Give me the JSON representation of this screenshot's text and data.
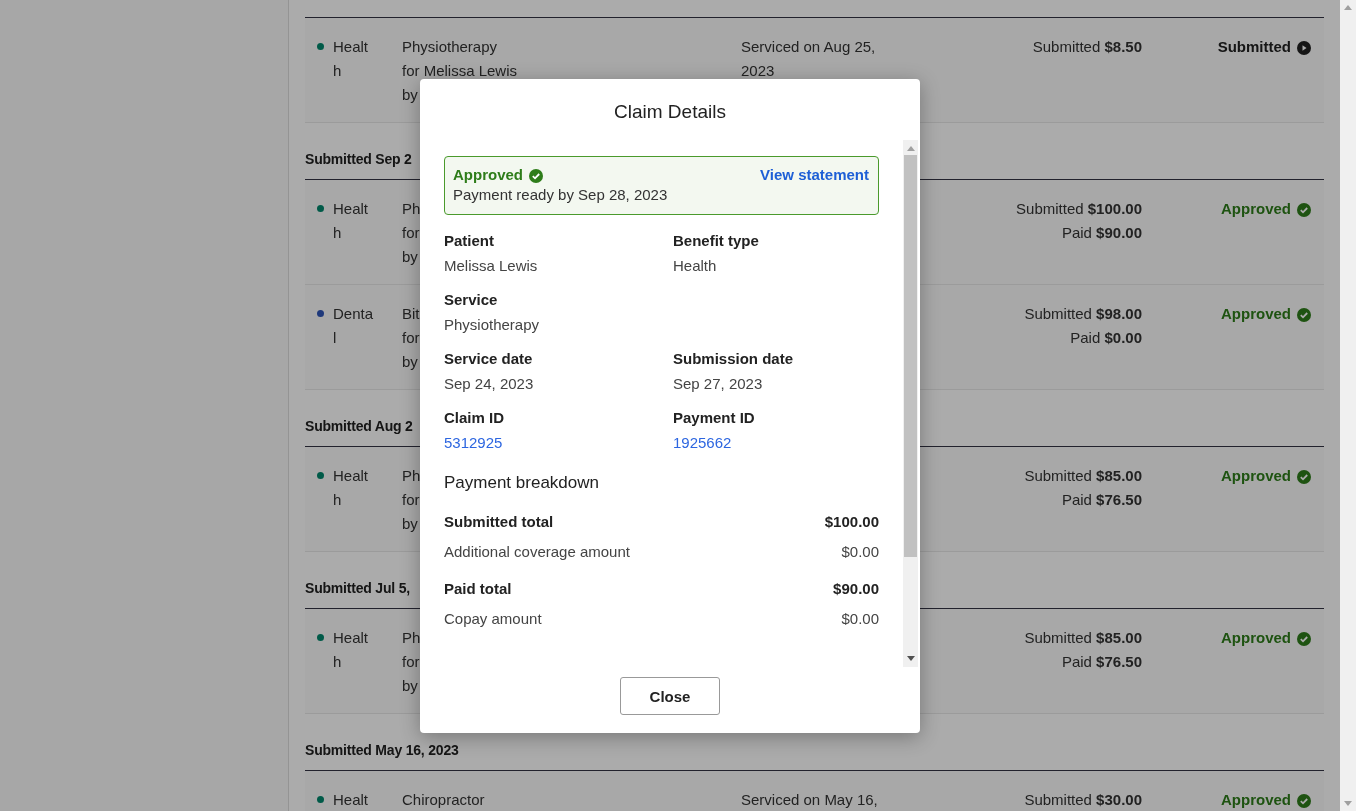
{
  "groups": [
    {
      "claims": [
        {
          "category": "Health",
          "color": "#005a48",
          "lines": [
            "Physiotherapy",
            "for Melissa Lewis",
            "by"
          ],
          "serviced": "Serviced on Aug 25, 2023",
          "submitted": "Submitted **$8.50**",
          "status": {
            "kind": "submitted",
            "label": "Submitted"
          }
        }
      ]
    },
    {
      "heading": "Submitted Sep 2",
      "claims": [
        {
          "category": "Health",
          "color": "#005a48",
          "lines": [
            "Ph",
            "for",
            "by"
          ],
          "submitted": "Submitted **$100.00**",
          "paid": "Paid **$90.00**",
          "status": {
            "kind": "approved",
            "label": "Approved"
          }
        },
        {
          "category": "Dental",
          "color": "#1f397b",
          "lines": [
            "Bit",
            "for",
            "by"
          ],
          "submitted": "Submitted **$98.00**",
          "paid": "Paid **$0.00**",
          "status": {
            "kind": "approved",
            "label": "Approved"
          }
        }
      ]
    },
    {
      "heading": "Submitted Aug 2",
      "claims": [
        {
          "category": "Health",
          "color": "#005a48",
          "lines": [
            "Ph",
            "for",
            "by"
          ],
          "submitted": "Submitted **$85.00**",
          "paid": "Paid **$76.50**",
          "status": {
            "kind": "approved",
            "label": "Approved"
          }
        }
      ]
    },
    {
      "heading": "Submitted Jul 5,",
      "claims": [
        {
          "category": "Health",
          "color": "#005a48",
          "lines": [
            "Ph",
            "for",
            "by"
          ],
          "submitted": "Submitted **$85.00**",
          "paid": "Paid **$76.50**",
          "status": {
            "kind": "approved",
            "label": "Approved"
          }
        }
      ]
    },
    {
      "heading": "Submitted May 16, 2023",
      "claims": [
        {
          "category": "Healt",
          "color": "#005a48",
          "lines": [
            "Chiropractor"
          ],
          "serviced": "Serviced on May 16,",
          "submitted": "Submitted **$30.00**",
          "status": {
            "kind": "approved",
            "label": "Approved"
          }
        }
      ]
    }
  ],
  "modal": {
    "title": "Claim Details",
    "banner": {
      "status": {
        "kind": "approved",
        "label": "Approved"
      },
      "note": "Payment ready by Sep 28, 2023",
      "link": "View statement"
    },
    "field_rows": [
      [
        {
          "label": "Patient",
          "value": "Melissa Lewis",
          "kind": "text"
        },
        {
          "label": "Benefit type",
          "value": "Health",
          "kind": "text"
        }
      ],
      [
        {
          "label": "Service",
          "value": "Physiotherapy",
          "kind": "text"
        }
      ],
      [
        {
          "label": "Service date",
          "value": "Sep 24, 2023",
          "kind": "text"
        },
        {
          "label": "Submission date",
          "value": "Sep 27, 2023",
          "kind": "text"
        }
      ],
      [
        {
          "label": "Claim ID",
          "value": "5312925",
          "kind": "link"
        },
        {
          "label": "Payment ID",
          "value": "1925662",
          "kind": "link"
        }
      ]
    ],
    "breakdown": {
      "heading": "Payment breakdown",
      "lines": [
        {
          "label": "Submitted total",
          "amount": "$100.00",
          "kind": "total"
        },
        {
          "label": "Additional coverage amount",
          "amount": "$0.00",
          "kind": "item"
        },
        {
          "label": "Paid total",
          "amount": "$90.00",
          "kind": "total"
        },
        {
          "label": "Copay amount",
          "amount": "$0.00",
          "kind": "item"
        }
      ]
    },
    "close": "Close"
  }
}
